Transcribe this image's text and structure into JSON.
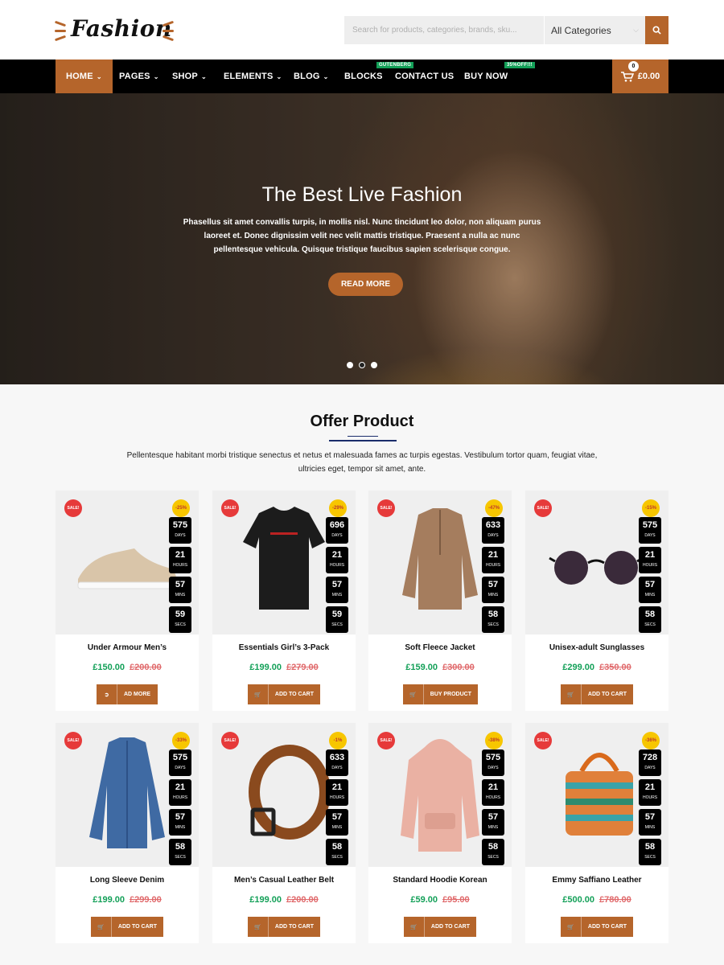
{
  "brand": {
    "logo_text": "Fashion"
  },
  "search": {
    "placeholder": "Search for products, categories, brands, sku...",
    "category": "All Categories"
  },
  "nav": {
    "items": [
      {
        "label": "Home"
      },
      {
        "label": "Pages"
      },
      {
        "label": "Shop"
      },
      {
        "label": "Elements"
      },
      {
        "label": "Blog"
      },
      {
        "label": "Blocks"
      },
      {
        "label": "Contact Us"
      },
      {
        "label": "Buy Now"
      }
    ],
    "badges": {
      "contact": "GUTENBERG",
      "buy": "35%OFF!!!"
    },
    "cart": {
      "count": "0",
      "total": "£0.00"
    }
  },
  "hero": {
    "title": "The Best Live Fashion",
    "text": "Phasellus sit amet convallis turpis, in mollis nisl. Nunc tincidunt leo dolor, non aliquam purus laoreet et. Donec dignissim velit nec velit mattis tristique. Praesent a nulla ac nunc pellentesque vehicula. Quisque tristique faucibus sapien scelerisque congue.",
    "button": "READ MORE"
  },
  "offer": {
    "title": "Offer Product",
    "desc": "Pellentesque habitant morbi tristique senectus et netus et malesuada fames ac turpis egestas. Vestibulum tortor quam, feugiat vitae, ultricies eget, tempor sit amet, ante.",
    "labels": {
      "sale": "SALE!",
      "days": "DAYS",
      "hours": "HOURS",
      "mins": "MINS",
      "secs": "SECS"
    },
    "products": [
      {
        "name": "Under Armour Men’s",
        "price": "£150.00",
        "old": "£200.00",
        "discount": "-25%",
        "days": "575",
        "hours": "21",
        "mins": "57",
        "secs": "59",
        "action": "AD MORE",
        "icon": "sign-in-icon"
      },
      {
        "name": "Essentials Girl’s 3-Pack",
        "price": "£199.00",
        "old": "£279.00",
        "discount": "-29%",
        "days": "696",
        "hours": "21",
        "mins": "57",
        "secs": "59",
        "action": "ADD TO CART",
        "icon": "cart-icon"
      },
      {
        "name": "Soft Fleece Jacket",
        "price": "£159.00",
        "old": "£300.00",
        "discount": "-47%",
        "days": "633",
        "hours": "21",
        "mins": "57",
        "secs": "58",
        "action": "BUY PRODUCT",
        "icon": "cart-icon"
      },
      {
        "name": "Unisex-adult Sunglasses",
        "price": "£299.00",
        "old": "£350.00",
        "discount": "-15%",
        "days": "575",
        "hours": "21",
        "mins": "57",
        "secs": "58",
        "action": "ADD TO CART",
        "icon": "cart-icon"
      },
      {
        "name": "Long Sleeve Denim",
        "price": "£199.00",
        "old": "£299.00",
        "discount": "-33%",
        "days": "575",
        "hours": "21",
        "mins": "57",
        "secs": "58",
        "action": "ADD TO CART",
        "icon": "cart-icon"
      },
      {
        "name": "Men’s Casual Leather Belt",
        "price": "£199.00",
        "old": "£200.00",
        "discount": "-1%",
        "days": "633",
        "hours": "21",
        "mins": "57",
        "secs": "58",
        "action": "ADD TO CART",
        "icon": "cart-icon"
      },
      {
        "name": "Standard Hoodie Korean",
        "price": "£59.00",
        "old": "£95.00",
        "discount": "-38%",
        "days": "575",
        "hours": "21",
        "mins": "57",
        "secs": "58",
        "action": "ADD TO CART",
        "icon": "cart-icon"
      },
      {
        "name": "Emmy Saffiano Leather",
        "price": "£500.00",
        "old": "£780.00",
        "discount": "-36%",
        "days": "728",
        "hours": "21",
        "mins": "57",
        "secs": "58",
        "action": "ADD TO CART",
        "icon": "cart-icon"
      }
    ]
  },
  "colors": {
    "accent": "#b5652b",
    "new_price": "#13a058",
    "old_price": "#e0696b",
    "sale": "#e63a3a",
    "discount": "#f7c600"
  }
}
